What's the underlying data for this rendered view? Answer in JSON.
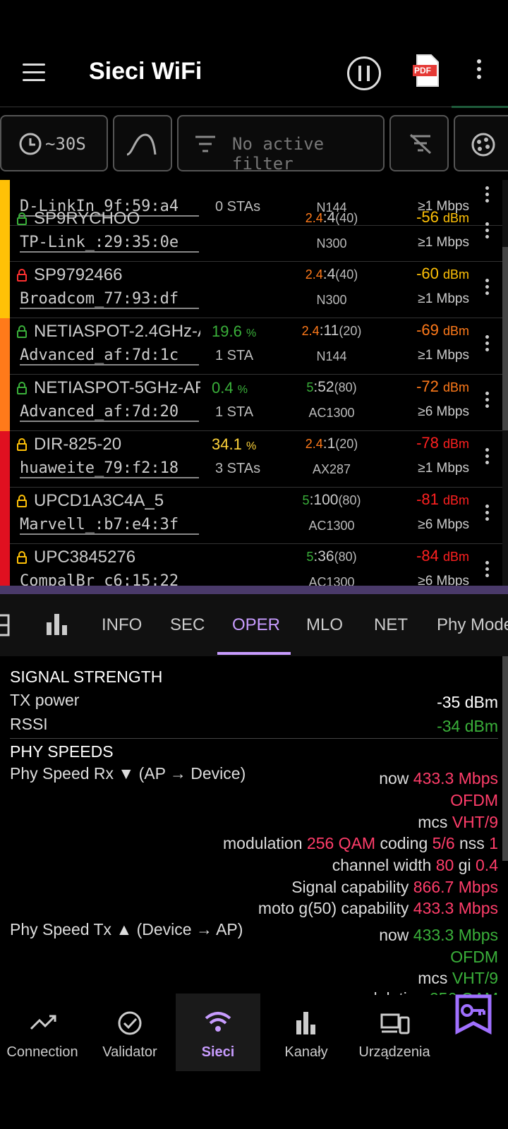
{
  "appbar": {
    "title": "Sieci WiFi",
    "pdf_label": "PDF"
  },
  "filters": {
    "time": "~30S",
    "filter": "No active filter"
  },
  "networks": [
    {
      "ssid": "",
      "mac": "D-LinkIn_9f:59:a4",
      "util": "",
      "sta": "0 STAs",
      "band": "",
      "chan": "",
      "width": "",
      "phy": "N144",
      "sig": "",
      "rate": "≥1 Mbps",
      "color": "#ffc107"
    },
    {
      "ssid": "SP9RYCHOO",
      "mac": "TP-Link_:29:35:0e",
      "util": "",
      "sta": "",
      "band": "2.4",
      "chan": ":4",
      "width": "(40)",
      "phy": "N300",
      "sig": "-56",
      "rate": "≥1 Mbps",
      "color": "#ffc107"
    },
    {
      "ssid": "SP9792466",
      "mac": "Broadcom_77:93:df",
      "util": "",
      "sta": "",
      "band": "2.4",
      "chan": ":4",
      "width": "(40)",
      "phy": "N300",
      "sig": "-60",
      "rate": "≥1 Mbps",
      "color": "#ffc107"
    },
    {
      "ssid": "NETIASPOT-2.4GHz-A",
      "mac": "Advanced_af:7d:1c",
      "util": "19.6",
      "sta": "1 STA",
      "band": "2.4",
      "chan": ":11",
      "width": "(20)",
      "phy": "N144",
      "sig": "-69",
      "rate": "≥1 Mbps",
      "color": "#ff7a1a"
    },
    {
      "ssid": "NETIASPOT-5GHz-AF",
      "mac": "Advanced_af:7d:20",
      "util": "0.4",
      "sta": "1 STA",
      "band": "5",
      "chan": ":52",
      "width": "(80)",
      "phy": "AC1300",
      "sig": "-72",
      "rate": "≥6 Mbps",
      "color": "#ff7a1a"
    },
    {
      "ssid": "DIR-825-20",
      "mac": "huaweite_79:f2:18",
      "util": "34.1",
      "sta": "3 STAs",
      "band": "2.4",
      "chan": ":1",
      "width": "(20)",
      "phy": "AX287",
      "sig": "-78",
      "rate": "≥1 Mbps",
      "color": "#e01020"
    },
    {
      "ssid": "UPCD1A3C4A_5",
      "mac": "Marvell_:b7:e4:3f",
      "util": "",
      "sta": "",
      "band": "5",
      "chan": ":100",
      "width": "(80)",
      "phy": "AC1300",
      "sig": "-81",
      "rate": "≥6 Mbps",
      "color": "#e01020"
    },
    {
      "ssid": "UPC3845276",
      "mac": "CompalBr_c6:15:22",
      "util": "",
      "sta": "",
      "band": "5",
      "chan": ":36",
      "width": "(80)",
      "phy": "AC1300",
      "sig": "-84",
      "rate": "≥6 Mbps",
      "color": "#e01020"
    }
  ],
  "units": {
    "dbm": "dBm",
    "pct": "%"
  },
  "tabs": [
    "INFO",
    "SEC",
    "OPER",
    "MLO",
    "NET",
    "Phy Mode"
  ],
  "details": {
    "signal_header": "SIGNAL STRENGTH",
    "tx_label": "TX power",
    "tx_value": "-35 dBm",
    "rssi_label": "RSSI",
    "rssi_value": "-34 dBm",
    "phy_header": "PHY SPEEDS",
    "rx_label": "Phy Speed Rx ▼ (AP → Device)",
    "tx2_label": "Phy Speed Tx ▲ (Device → AP)",
    "now": "now",
    "rx_speed": "433.3 Mbps",
    "ofdm": "OFDM",
    "mcs": "mcs",
    "mcs_val": "VHT/9",
    "modulation": "modulation",
    "mod_val": "256 QAM",
    "coding": "coding",
    "coding_val": "5/6",
    "nss": "nss",
    "nss_val": "1",
    "chw": "channel width",
    "chw_val": "80",
    "gi": "gi",
    "gi_val": "0.4",
    "sigcap": "Signal capability",
    "sigcap_val": "866.7 Mbps",
    "devcap": "moto g(50) capability",
    "devcap_val": "433.3 Mbps",
    "tx_speed": "433.3 Mbps"
  },
  "nav": [
    "Connection",
    "Validator",
    "Sieci",
    "Kanały",
    "Urządzenia"
  ]
}
